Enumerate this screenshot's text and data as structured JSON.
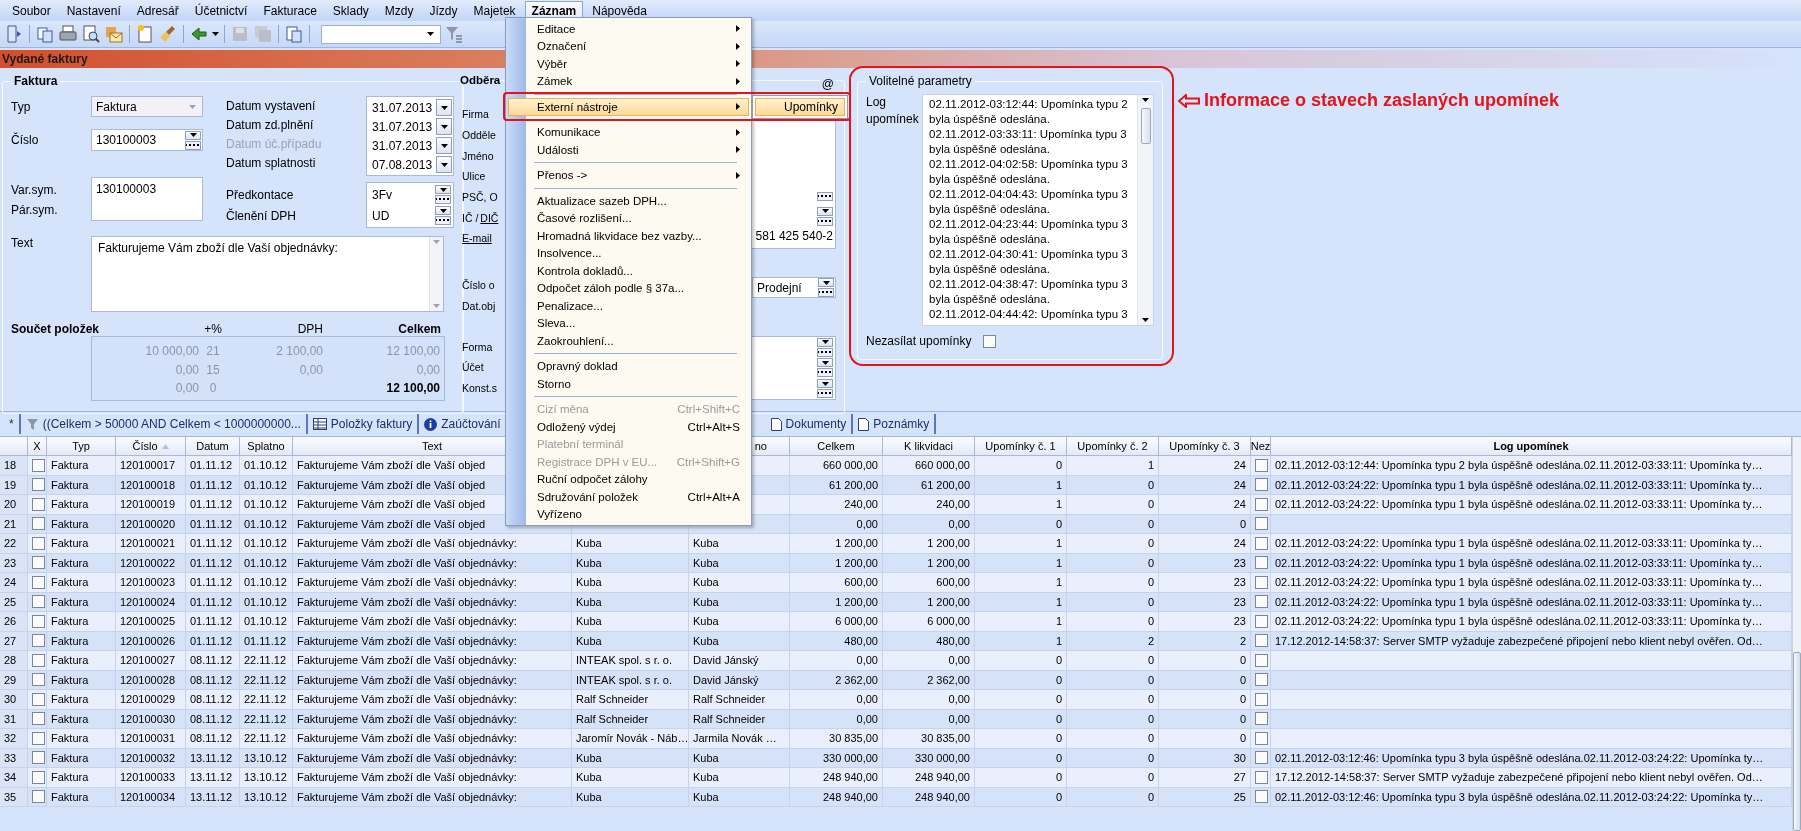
{
  "menu_bar": [
    {
      "label": "Soubor",
      "selected": false
    },
    {
      "label": "Nastavení",
      "selected": false
    },
    {
      "label": "Adresář",
      "selected": false
    },
    {
      "label": "Účetnictví",
      "selected": false
    },
    {
      "label": "Fakturace",
      "selected": false
    },
    {
      "label": "Sklady",
      "selected": false
    },
    {
      "label": "Mzdy",
      "selected": false
    },
    {
      "label": "Jízdy",
      "selected": false
    },
    {
      "label": "Majetek",
      "selected": false
    },
    {
      "label": "Záznam",
      "selected": true
    },
    {
      "label": "Nápověda",
      "selected": false
    }
  ],
  "module_title": "Vydané faktury",
  "invoice": {
    "legend": "Faktura",
    "type": {
      "label": "Typ",
      "value": "Faktura"
    },
    "number": {
      "label": "Číslo",
      "value": "130100003"
    },
    "symbols": {
      "labels": [
        "Var.sym.",
        "Pár.sym."
      ],
      "value": "130100003"
    },
    "dates": [
      {
        "label": "Datum vystavení",
        "value": "31.07.2013",
        "disabled": false
      },
      {
        "label": "Datum zd.plnění",
        "value": "31.07.2013",
        "disabled": false
      },
      {
        "label": "Datum úč.případu",
        "value": "31.07.2013",
        "disabled": true
      },
      {
        "label": "Datum splatnosti",
        "value": "07.08.2013",
        "disabled": false
      }
    ],
    "codes": [
      {
        "label": "Předkontace",
        "value": "3Fv"
      },
      {
        "label": "Členění DPH",
        "value": "UD"
      }
    ],
    "text": {
      "label": "Text",
      "value": "Fakturujeme Vám zboží dle Vaší objednávky:"
    },
    "totals": {
      "title": "Součet položek",
      "columns": [
        "+%",
        "DPH",
        "Celkem"
      ],
      "rows": [
        {
          "base": "10 000,00",
          "rate": "21",
          "vat": "2 100,00",
          "total": "12 100,00",
          "grand": false
        },
        {
          "base": "0,00",
          "rate": "15",
          "vat": "0,00",
          "total": "0,00",
          "grand": false
        },
        {
          "base": "0,00",
          "rate": "0",
          "total": "12 100,00",
          "grand": true
        }
      ]
    }
  },
  "customer": {
    "legend": "Odběra",
    "at": "@",
    "label_groups": [
      [
        {
          "parts": [
            {
              "text": "Firma",
              "link": false
            }
          ]
        },
        {
          "parts": [
            {
              "text": "Odděle",
              "link": false
            }
          ]
        },
        {
          "parts": [
            {
              "text": "Jméno",
              "link": false
            }
          ]
        },
        {
          "parts": [
            {
              "text": "Ulice",
              "link": false
            }
          ]
        },
        {
          "parts": [
            {
              "text": "PSČ, O",
              "link": false
            }
          ]
        },
        {
          "parts": [
            {
              "text": "IČ /",
              "link": false
            },
            {
              "text": "DIČ",
              "link": true
            }
          ]
        },
        {
          "parts": [
            {
              "text": "E-mail",
              "link": true
            }
          ]
        }
      ],
      [
        {
          "parts": [
            {
              "text": "Číslo o",
              "link": false
            }
          ]
        },
        {
          "parts": [
            {
              "text": "Dat.obj",
              "link": false
            }
          ]
        }
      ],
      [
        {
          "parts": [
            {
              "text": "Forma",
              "link": false
            }
          ]
        },
        {
          "parts": [
            {
              "text": "Účet",
              "link": false
            }
          ]
        },
        {
          "parts": [
            {
              "text": "Konst.s",
              "link": false
            }
          ]
        }
      ]
    ],
    "phone": "581 425 540-2",
    "order_type": "Prodejní"
  },
  "optional": {
    "legend": "Volitelné parametry",
    "log_label": "Log upomínek",
    "log": [
      "02.11.2012-03:12:44: Upomínka typu 2 byla úspěšně odeslána.",
      "02.11.2012-03:33:11: Upomínka typu 3 byla úspěšně odeslána.",
      "02.11.2012-04:02:58: Upomínka typu 3 byla úspěšně odeslána.",
      "02.11.2012-04:04:43: Upomínka typu 3 byla úspěšně odeslána.",
      "02.11.2012-04:23:44: Upomínka typu 3 byla úspěšně odeslána.",
      "02.11.2012-04:30:41: Upomínka typu 3 byla úspěšně odeslána.",
      "02.11.2012-04:38:47: Upomínka typu 3 byla úspěšně odeslána.",
      "02.11.2012-04:44:42: Upomínka typu 3"
    ],
    "no_reminders": {
      "label": "Nezasílat upomínky",
      "checked": false
    }
  },
  "note": "Informace o stavech zaslaných upomínek",
  "tabs": [
    {
      "kind": "new",
      "label": "*"
    },
    {
      "kind": "filter",
      "label": "((Celkem > 50000 AND Celkem < 1000000000..."
    },
    {
      "kind": "items",
      "label": "Položky faktury"
    },
    {
      "kind": "info",
      "label": "Zaúčtování"
    },
    {
      "kind": "documents",
      "label": "Dokumenty"
    },
    {
      "kind": "notes",
      "label": "Poznámky"
    }
  ],
  "table": {
    "columns": [
      {
        "sorted": false
      },
      {
        "label": "X",
        "sorted": false
      },
      {
        "label": "Typ",
        "sorted": false
      },
      {
        "label": "Číslo",
        "sorted": true
      },
      {
        "label": "Datum",
        "sorted": false
      },
      {
        "label": "Splatno",
        "sorted": false
      },
      {
        "label": "Text",
        "sorted": false
      },
      {},
      {
        "label": "no",
        "sorted": false
      },
      {
        "label": "Celkem",
        "sorted": false
      },
      {
        "label": "K likvidaci",
        "sorted": false
      },
      {
        "label": "Upomínky č. 1",
        "sorted": false
      },
      {
        "label": "Upomínky č. 2",
        "sorted": false
      },
      {
        "label": "Upomínky č. 3",
        "sorted": false
      },
      {
        "label": "Nez",
        "sorted": false
      },
      {
        "label": "Log upomínek",
        "sorted": false
      }
    ],
    "rows": [
      {
        "n": "18",
        "x": false,
        "type": "Faktura",
        "number": "120100017",
        "date": "01.11.12",
        "due": "01.10.12",
        "text": "Fakturujeme Vám zboží dle Vaší objed",
        "total": "660 000,00",
        "to_pay": "660 000,00",
        "r1": "0",
        "r2": "1",
        "r3": "24",
        "skip": false,
        "log": "02.11.2012-03:12:44: Upomínka typu 2 byla úspěšně odeslána.02.11.2012-03:33:11: Upomínka ty…"
      },
      {
        "n": "19",
        "x": false,
        "type": "Faktura",
        "number": "120100018",
        "date": "01.11.12",
        "due": "01.10.12",
        "text": "Fakturujeme Vám zboží dle Vaší objed",
        "total": "61 200,00",
        "to_pay": "61 200,00",
        "r1": "1",
        "r2": "0",
        "r3": "24",
        "skip": false,
        "log": "02.11.2012-03:24:22: Upomínka typu 1 byla úspěšně odeslána.02.11.2012-03:33:11: Upomínka ty…"
      },
      {
        "n": "20",
        "x": false,
        "type": "Faktura",
        "number": "120100019",
        "date": "01.11.12",
        "due": "01.10.12",
        "text": "Fakturujeme Vám zboží dle Vaší objed",
        "total": "240,00",
        "to_pay": "240,00",
        "r1": "1",
        "r2": "0",
        "r3": "24",
        "skip": false,
        "log": "02.11.2012-03:24:22: Upomínka typu 1 byla úspěšně odeslána.02.11.2012-03:33:11: Upomínka ty…"
      },
      {
        "n": "21",
        "x": false,
        "type": "Faktura",
        "number": "120100020",
        "date": "01.11.12",
        "due": "01.10.12",
        "text": "Fakturujeme Vám zboží dle Vaší objed",
        "total": "0,00",
        "to_pay": "0,00",
        "r1": "0",
        "r2": "0",
        "r3": "0",
        "skip": false
      },
      {
        "n": "22",
        "x": false,
        "type": "Faktura",
        "number": "120100021",
        "date": "01.11.12",
        "due": "01.10.12",
        "text": "Fakturujeme Vám zboží dle Vaší objednávky:",
        "firm": "Kuba",
        "name": "Kuba",
        "total": "1 200,00",
        "to_pay": "1 200,00",
        "r1": "1",
        "r2": "0",
        "r3": "24",
        "skip": false,
        "log": "02.11.2012-03:24:22: Upomínka typu 1 byla úspěšně odeslána.02.11.2012-03:33:11: Upomínka ty…"
      },
      {
        "n": "23",
        "x": false,
        "type": "Faktura",
        "number": "120100022",
        "date": "01.11.12",
        "due": "01.10.12",
        "text": "Fakturujeme Vám zboží dle Vaší objednávky:",
        "firm": "Kuba",
        "name": "Kuba",
        "total": "1 200,00",
        "to_pay": "1 200,00",
        "r1": "1",
        "r2": "0",
        "r3": "23",
        "skip": false,
        "log": "02.11.2012-03:24:22: Upomínka typu 1 byla úspěšně odeslána.02.11.2012-03:33:11: Upomínka ty…"
      },
      {
        "n": "24",
        "x": false,
        "type": "Faktura",
        "number": "120100023",
        "date": "01.11.12",
        "due": "01.10.12",
        "text": "Fakturujeme Vám zboží dle Vaší objednávky:",
        "firm": "Kuba",
        "name": "Kuba",
        "total": "600,00",
        "to_pay": "600,00",
        "r1": "1",
        "r2": "0",
        "r3": "23",
        "skip": false,
        "log": "02.11.2012-03:24:22: Upomínka typu 1 byla úspěšně odeslána.02.11.2012-03:33:11: Upomínka ty…"
      },
      {
        "n": "25",
        "x": false,
        "type": "Faktura",
        "number": "120100024",
        "date": "01.11.12",
        "due": "01.10.12",
        "text": "Fakturujeme Vám zboží dle Vaší objednávky:",
        "firm": "Kuba",
        "name": "Kuba",
        "total": "1 200,00",
        "to_pay": "1 200,00",
        "r1": "1",
        "r2": "0",
        "r3": "23",
        "skip": false,
        "log": "02.11.2012-03:24:22: Upomínka typu 1 byla úspěšně odeslána.02.11.2012-03:33:11: Upomínka ty…"
      },
      {
        "n": "26",
        "x": false,
        "type": "Faktura",
        "number": "120100025",
        "date": "01.11.12",
        "due": "01.10.12",
        "text": "Fakturujeme Vám zboží dle Vaší objednávky:",
        "firm": "Kuba",
        "name": "Kuba",
        "total": "6 000,00",
        "to_pay": "6 000,00",
        "r1": "1",
        "r2": "0",
        "r3": "23",
        "skip": false,
        "log": "02.11.2012-03:24:22: Upomínka typu 1 byla úspěšně odeslána.02.11.2012-03:33:11: Upomínka ty…"
      },
      {
        "n": "27",
        "x": false,
        "type": "Faktura",
        "number": "120100026",
        "date": "01.11.12",
        "due": "01.11.12",
        "text": "Fakturujeme Vám zboží dle Vaší objednávky:",
        "firm": "Kuba",
        "name": "Kuba",
        "total": "480,00",
        "to_pay": "480,00",
        "r1": "1",
        "r2": "2",
        "r3": "2",
        "skip": false,
        "log": "17.12.2012-14:58:37: Server SMTP vyžaduje zabezpečené připojení nebo klient nebyl ověřen. Od…"
      },
      {
        "n": "28",
        "x": false,
        "type": "Faktura",
        "number": "120100027",
        "date": "08.11.12",
        "due": "22.11.12",
        "text": "Fakturujeme Vám zboží dle Vaší objednávky:",
        "firm": "INTEAK spol. s r. o.",
        "name": "David Jánský",
        "total": "0,00",
        "to_pay": "0,00",
        "r1": "0",
        "r2": "0",
        "r3": "0",
        "skip": false
      },
      {
        "n": "29",
        "x": false,
        "type": "Faktura",
        "number": "120100028",
        "date": "08.11.12",
        "due": "22.11.12",
        "text": "Fakturujeme Vám zboží dle Vaší objednávky:",
        "firm": "INTEAK spol. s r. o.",
        "name": "David Jánský",
        "total": "2 362,00",
        "to_pay": "2 362,00",
        "r1": "0",
        "r2": "0",
        "r3": "0",
        "skip": false
      },
      {
        "n": "30",
        "x": false,
        "type": "Faktura",
        "number": "120100029",
        "date": "08.11.12",
        "due": "22.11.12",
        "text": "Fakturujeme Vám zboží dle Vaší objednávky:",
        "firm": "Ralf Schneider",
        "name": "Ralf Schneider",
        "total": "0,00",
        "to_pay": "0,00",
        "r1": "0",
        "r2": "0",
        "r3": "0",
        "skip": false
      },
      {
        "n": "31",
        "x": false,
        "type": "Faktura",
        "number": "120100030",
        "date": "08.11.12",
        "due": "22.11.12",
        "text": "Fakturujeme Vám zboží dle Vaší objednávky:",
        "firm": "Ralf Schneider",
        "name": "Ralf Schneider",
        "total": "0,00",
        "to_pay": "0,00",
        "r1": "0",
        "r2": "0",
        "r3": "0",
        "skip": false
      },
      {
        "n": "32",
        "x": false,
        "type": "Faktura",
        "number": "120100031",
        "date": "08.11.12",
        "due": "22.11.12",
        "text": "Fakturujeme Vám zboží dle Vaší objednávky:",
        "firm": "Jaromír Novák - Náb…",
        "name": "Jarmila Novák …",
        "total": "30 835,00",
        "to_pay": "30 835,00",
        "r1": "0",
        "r2": "0",
        "r3": "0",
        "skip": false
      },
      {
        "n": "33",
        "x": false,
        "type": "Faktura",
        "number": "120100032",
        "date": "13.11.12",
        "due": "13.10.12",
        "text": "Fakturujeme Vám zboží dle Vaší objednávky:",
        "firm": "Kuba",
        "name": "Kuba",
        "total": "330 000,00",
        "to_pay": "330 000,00",
        "r1": "0",
        "r2": "0",
        "r3": "30",
        "skip": false,
        "log": "02.11.2012-03:12:46: Upomínka typu 3 byla úspěšně odeslána.02.11.2012-03:24:22: Upomínka ty…"
      },
      {
        "n": "34",
        "x": false,
        "type": "Faktura",
        "number": "120100033",
        "date": "13.11.12",
        "due": "13.10.12",
        "text": "Fakturujeme Vám zboží dle Vaší objednávky:",
        "firm": "Kuba",
        "name": "Kuba",
        "total": "248 940,00",
        "to_pay": "248 940,00",
        "r1": "0",
        "r2": "0",
        "r3": "27",
        "skip": false,
        "log": "17.12.2012-14:58:37: Server SMTP vyžaduje zabezpečené připojení nebo klient nebyl ověřen. Od…"
      },
      {
        "n": "35",
        "x": false,
        "type": "Faktura",
        "number": "120100034",
        "date": "13.11.12",
        "due": "13.10.12",
        "text": "Fakturujeme Vám zboží dle Vaší objednávky:",
        "firm": "Kuba",
        "name": "Kuba",
        "total": "248 940,00",
        "to_pay": "248 940,00",
        "r1": "0",
        "r2": "0",
        "r3": "25",
        "skip": false,
        "log": "02.11.2012-03:12:46: Upomínka typu 3 byla úspěšně odeslána.02.11.2012-03:24:22: Upomínka ty…"
      }
    ]
  },
  "menu": {
    "items": [
      {
        "kind": "item",
        "label": "Editace",
        "submenu": true,
        "disabled": false,
        "selected": false
      },
      {
        "kind": "item",
        "label": "Označení",
        "submenu": true,
        "disabled": false,
        "selected": false
      },
      {
        "kind": "item",
        "label": "Výběr",
        "submenu": true,
        "disabled": false,
        "selected": false
      },
      {
        "kind": "item",
        "label": "Zámek",
        "submenu": true,
        "disabled": false,
        "selected": false
      },
      {
        "kind": "separator"
      },
      {
        "kind": "item",
        "label": "Externí nástroje",
        "submenu": true,
        "disabled": false,
        "selected": true
      },
      {
        "kind": "separator"
      },
      {
        "kind": "item",
        "label": "Komunikace",
        "submenu": true,
        "disabled": false,
        "selected": false
      },
      {
        "kind": "item",
        "label": "Události",
        "submenu": true,
        "disabled": false,
        "selected": false
      },
      {
        "kind": "separator"
      },
      {
        "kind": "item",
        "label": "Přenos ->",
        "submenu": true,
        "disabled": false,
        "selected": false
      },
      {
        "kind": "separator"
      },
      {
        "kind": "item",
        "label": "Aktualizace sazeb DPH...",
        "submenu": false,
        "disabled": false,
        "selected": false
      },
      {
        "kind": "item",
        "label": "Časové rozlišení...",
        "submenu": false,
        "disabled": false,
        "selected": false
      },
      {
        "kind": "item",
        "label": "Hromadná likvidace bez vazby...",
        "submenu": false,
        "disabled": false,
        "selected": false
      },
      {
        "kind": "item",
        "label": "Insolvence...",
        "submenu": false,
        "disabled": false,
        "selected": false
      },
      {
        "kind": "item",
        "label": "Kontrola dokladů...",
        "submenu": false,
        "disabled": false,
        "selected": false
      },
      {
        "kind": "item",
        "label": "Odpočet záloh podle § 37a...",
        "submenu": false,
        "disabled": false,
        "selected": false
      },
      {
        "kind": "item",
        "label": "Penalizace...",
        "submenu": false,
        "disabled": false,
        "selected": false
      },
      {
        "kind": "item",
        "label": "Sleva...",
        "submenu": false,
        "disabled": false,
        "selected": false
      },
      {
        "kind": "item",
        "label": "Zaokrouhlení...",
        "submenu": false,
        "disabled": false,
        "selected": false
      },
      {
        "kind": "separator"
      },
      {
        "kind": "item",
        "label": "Opravný doklad",
        "submenu": false,
        "disabled": false,
        "selected": false
      },
      {
        "kind": "item",
        "label": "Storno",
        "submenu": false,
        "disabled": false,
        "selected": false
      },
      {
        "kind": "separator"
      },
      {
        "kind": "item",
        "label": "Cizí měna",
        "shortcut": "Ctrl+Shift+C",
        "submenu": false,
        "disabled": true,
        "selected": false
      },
      {
        "kind": "item",
        "label": "Odložený výdej",
        "shortcut": "Ctrl+Alt+S",
        "submenu": false,
        "disabled": false,
        "selected": false
      },
      {
        "kind": "item",
        "label": "Platební terminál",
        "submenu": false,
        "disabled": true,
        "selected": false
      },
      {
        "kind": "item",
        "label": "Registrace DPH v EU...",
        "shortcut": "Ctrl+Shift+G",
        "submenu": false,
        "disabled": true,
        "selected": false
      },
      {
        "kind": "item",
        "label": "Ruční odpočet zálohy",
        "submenu": false,
        "disabled": false,
        "selected": false
      },
      {
        "kind": "item",
        "label": "Sdružování položek",
        "shortcut": "Ctrl+Alt+A",
        "submenu": false,
        "disabled": false,
        "selected": false
      },
      {
        "kind": "item",
        "label": "Vyřízeno",
        "submenu": false,
        "disabled": false,
        "selected": false
      }
    ],
    "submenu": [
      {
        "label": "Upomínky",
        "selected": true
      }
    ]
  }
}
